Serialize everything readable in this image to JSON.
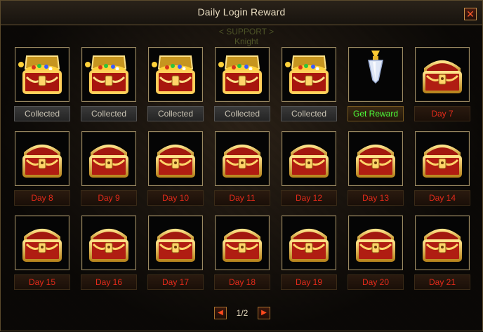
{
  "window": {
    "title": "Daily Login Reward",
    "close_icon": "close-icon"
  },
  "background_text": {
    "line1": "< SUPPORT >",
    "line2": "Knight"
  },
  "rewards": [
    {
      "label": "Collected",
      "state": "collected",
      "icon": "gold-chest-open-icon"
    },
    {
      "label": "Collected",
      "state": "collected",
      "icon": "gold-chest-open-icon"
    },
    {
      "label": "Collected",
      "state": "collected",
      "icon": "gold-chest-open-icon"
    },
    {
      "label": "Collected",
      "state": "collected",
      "icon": "gold-chest-open-icon"
    },
    {
      "label": "Collected",
      "state": "collected",
      "icon": "gold-chest-open-icon"
    },
    {
      "label": "Get Reward",
      "state": "available",
      "icon": "crystal-amulet-icon"
    },
    {
      "label": "Day 7",
      "state": "locked",
      "icon": "treasure-chest-icon"
    },
    {
      "label": "Day 8",
      "state": "locked",
      "icon": "treasure-chest-icon"
    },
    {
      "label": "Day 9",
      "state": "locked",
      "icon": "treasure-chest-icon"
    },
    {
      "label": "Day 10",
      "state": "locked",
      "icon": "treasure-chest-icon"
    },
    {
      "label": "Day 11",
      "state": "locked",
      "icon": "treasure-chest-icon"
    },
    {
      "label": "Day 12",
      "state": "locked",
      "icon": "treasure-chest-icon"
    },
    {
      "label": "Day 13",
      "state": "locked",
      "icon": "treasure-chest-icon"
    },
    {
      "label": "Day 14",
      "state": "locked",
      "icon": "treasure-chest-icon"
    },
    {
      "label": "Day 15",
      "state": "locked",
      "icon": "treasure-chest-icon"
    },
    {
      "label": "Day 16",
      "state": "locked",
      "icon": "treasure-chest-icon"
    },
    {
      "label": "Day 17",
      "state": "locked",
      "icon": "treasure-chest-icon"
    },
    {
      "label": "Day 18",
      "state": "locked",
      "icon": "treasure-chest-icon"
    },
    {
      "label": "Day 19",
      "state": "locked",
      "icon": "treasure-chest-icon"
    },
    {
      "label": "Day 20",
      "state": "locked",
      "icon": "treasure-chest-icon"
    },
    {
      "label": "Day 21",
      "state": "locked",
      "icon": "treasure-chest-icon"
    }
  ],
  "pagination": {
    "current": "1/2",
    "prev_icon": "arrow-left-icon",
    "next_icon": "arrow-right-icon"
  },
  "colors": {
    "day_label": "#e42a1a",
    "get_reward": "#4cff3a",
    "collected": "#c8c2b2",
    "frame": "#9b8a62"
  }
}
